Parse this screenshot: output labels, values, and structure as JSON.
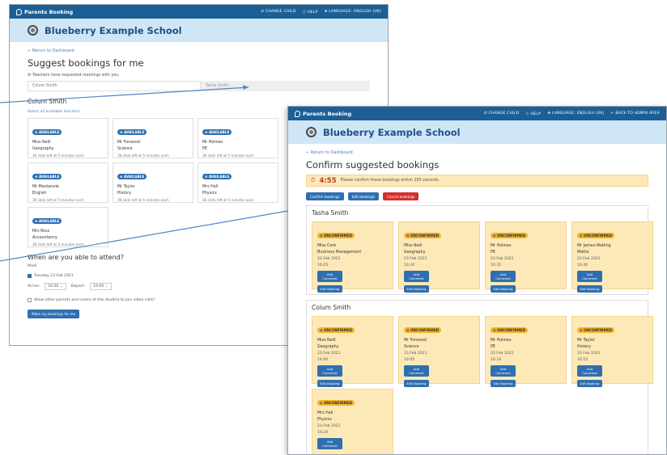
{
  "back": {
    "app_name": "Parents Booking",
    "nav": [
      "CHANGE CHILD",
      "HELP",
      "LANGUAGE: ENGLISH (UK)"
    ],
    "school_name": "Blueberry Example School",
    "back_link": "Return to Dashboard",
    "page_title": "Suggest bookings for me",
    "note": "Teachers have requested meetings with you.",
    "child_field_value": "Colum Smith",
    "child_placeholder": "Tasha Smith",
    "student_name": "Colum Smith",
    "select_all": "Select all available teachers",
    "badge": "AVAILABLE",
    "teachers": [
      {
        "teacher": "Miss Neill",
        "subject": "Geography",
        "slots": "36 slots left at 5 minutes each"
      },
      {
        "teacher": "Mr Forwood",
        "subject": "Science",
        "slots": "36 slots left at 5 minutes each"
      },
      {
        "teacher": "Mr Holmes",
        "subject": "PE",
        "slots": "36 slots left at 5 minutes each"
      },
      {
        "teacher": "Mr Mackenzie",
        "subject": "English",
        "slots": "36 slots left at 5 minutes each"
      },
      {
        "teacher": "Mr Taylor",
        "subject": "History",
        "slots": "36 slots left at 5 minutes each"
      },
      {
        "teacher": "Mrs Hall",
        "subject": "Physics",
        "slots": "36 slots left at 5 minutes each"
      },
      {
        "teacher": "Mrs Ross",
        "subject": "Accountancy",
        "slots": "36 slots left at 5 minutes each"
      }
    ],
    "attend_title": "When are you able to attend?",
    "attend_head": "Mark",
    "attend_date": "Tuesday 23 Feb 2021",
    "arrive_label": "Arrive:",
    "arrive_value": "16:00",
    "depart_label": "Depart:",
    "depart_value": "19:00",
    "video_text": "Allow other parents and carers of this student to join video calls?",
    "make_button": "Make my bookings for me"
  },
  "front": {
    "app_name": "Parents Booking",
    "nav": [
      "CHANGE CHILD",
      "HELP",
      "LANGUAGE: ENGLISH (UK)",
      "BACK TO ADMIN AREA"
    ],
    "school_name": "Blueberry Example School",
    "back_link": "Return to Dashboard",
    "page_title": "Confirm suggested bookings",
    "timer_value": "4:55",
    "timer_text": "Please confirm these bookings within 295 seconds.",
    "confirm_button": "Confirm bookings",
    "edit_button": "Edit bookings",
    "cancel_button": "Cancel bookings",
    "badge": "UNCONFIRMED",
    "add_comment": "Add Comment",
    "edit_booking": "Edit Booking",
    "students": [
      {
        "name": "Tasha Smith",
        "bookings": [
          {
            "teacher": "Miss Core",
            "subject": "Business Management",
            "date": "23 Feb 2021",
            "time": "16:25"
          },
          {
            "teacher": "Miss Neill",
            "subject": "Geography",
            "date": "23 Feb 2021",
            "time": "16:30"
          },
          {
            "teacher": "Mr Holmes",
            "subject": "PE",
            "date": "23 Feb 2021",
            "time": "16:35"
          },
          {
            "teacher": "Mr James-Watling",
            "subject": "Maths",
            "date": "23 Feb 2021",
            "time": "16:40"
          }
        ]
      },
      {
        "name": "Colum Smith",
        "bookings": [
          {
            "teacher": "Miss Neill",
            "subject": "Geography",
            "date": "23 Feb 2021",
            "time": "16:00"
          },
          {
            "teacher": "Mr Forwood",
            "subject": "Science",
            "date": "23 Feb 2021",
            "time": "16:05"
          },
          {
            "teacher": "Mr Holmes",
            "subject": "PE",
            "date": "23 Feb 2021",
            "time": "16:10"
          },
          {
            "teacher": "Mr Taylor",
            "subject": "History",
            "date": "23 Feb 2021",
            "time": "16:15"
          },
          {
            "teacher": "Mrs Hall",
            "subject": "Physics",
            "date": "23 Feb 2021",
            "time": "16:20"
          }
        ]
      }
    ]
  }
}
